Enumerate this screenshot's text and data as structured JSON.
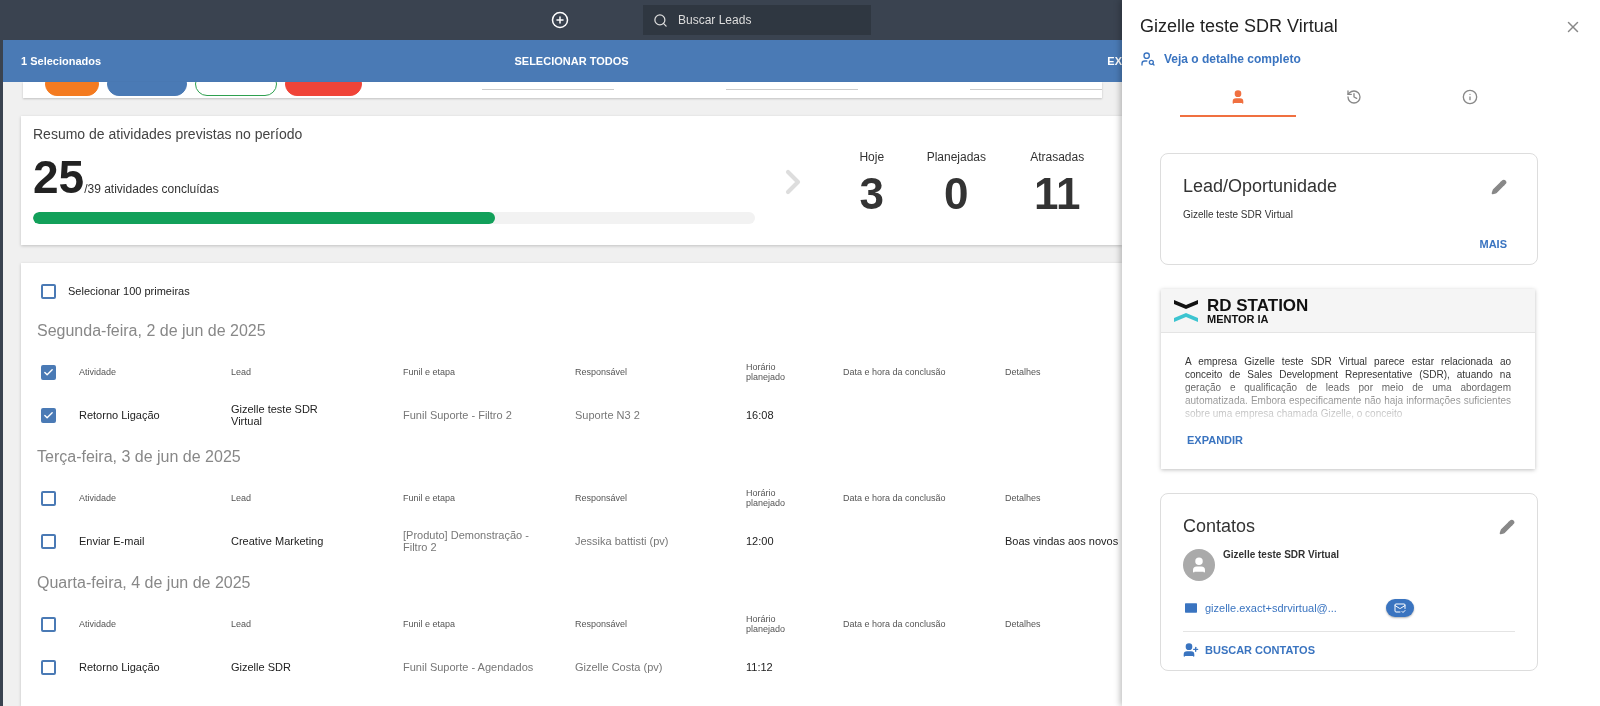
{
  "topbar": {
    "search": {
      "placeholder": "Buscar Leads"
    }
  },
  "selection_bar": {
    "count": "1 Selecionados",
    "select_all": "SELECIONAR TODOS",
    "action": "EX"
  },
  "filters": {
    "chips": [
      {
        "kind": "filled",
        "color": "#f47b20"
      },
      {
        "kind": "filled",
        "color": "#4a7ab5"
      },
      {
        "kind": "outline",
        "color": "#2ea04f"
      },
      {
        "kind": "filled",
        "color": "#f04438"
      }
    ],
    "fields": [
      {
        "kind": "select"
      },
      {
        "kind": "select"
      },
      {
        "kind": "select"
      }
    ]
  },
  "summary": {
    "title": "Resumo de atividades previstas no período",
    "done": "25",
    "total": "/39 atividades concluídas",
    "level": 0.64,
    "stats": [
      {
        "label": "Hoje",
        "value": "3"
      },
      {
        "label": "Planejadas",
        "value": "0"
      },
      {
        "label": "Atrasadas",
        "value": "11"
      }
    ]
  },
  "list": {
    "select_first": {
      "label": "Selecionar 100 primeiras",
      "checked": false
    },
    "groups": [
      {
        "date": "Segunda-feira, 2 de jun de 2025",
        "header_checked": true,
        "columns": [
          "Atividade",
          "Lead",
          "Funil e etapa",
          "Responsável",
          "Horário planejado",
          "Data e hora da conclusão",
          "Detalhes"
        ],
        "rows": [
          {
            "checked": true,
            "cells": [
              "Retorno Ligação",
              "Gizelle teste SDR Virtual",
              "Funil Suporte - Filtro 2",
              "Suporte N3 2",
              "16:08",
              "",
              ""
            ]
          }
        ]
      },
      {
        "date": "Terça-feira, 3 de jun de 2025",
        "header_checked": false,
        "columns": [
          "Atividade",
          "Lead",
          "Funil e etapa",
          "Responsável",
          "Horário planejado",
          "Data e hora da conclusão",
          "Detalhes"
        ],
        "rows": [
          {
            "checked": false,
            "cells": [
              "Enviar E-mail",
              "Creative Marketing",
              "[Produto] Demonstração - Filtro 2",
              "Jessika battisti (pv)",
              "12:00",
              "",
              "Boas vindas aos novos"
            ]
          }
        ]
      },
      {
        "date": "Quarta-feira, 4 de jun de 2025",
        "header_checked": false,
        "columns": [
          "Atividade",
          "Lead",
          "Funil e etapa",
          "Responsável",
          "Horário planejado",
          "Data e hora da conclusão",
          "Detalhes"
        ],
        "rows": [
          {
            "checked": false,
            "cells": [
              "Retorno Ligação",
              "Gizelle SDR",
              "Funil Suporte - Agendados",
              "Gizelle Costa (pv)",
              "11:12",
              "",
              ""
            ]
          }
        ]
      }
    ]
  },
  "drawer": {
    "title": "Gizelle teste SDR Virtual",
    "link": "Veja o detalhe completo",
    "tabs": [
      {
        "kind": "person",
        "selected": true
      },
      {
        "kind": "history",
        "selected": false
      },
      {
        "kind": "info",
        "selected": false
      }
    ],
    "lead_card": {
      "title": "Lead/Oportunidade",
      "name": "Gizelle teste SDR Virtual",
      "more": "MAIS"
    },
    "mentor": {
      "brand": "RD STATION",
      "sub": "MENTOR IA",
      "text": "A empresa Gizelle teste SDR Virtual parece estar relacionada ao conceito de Sales Development Representative (SDR), atuando na geração e qualificação de leads por meio de uma abordagem automatizada. Embora especificamente não haja informações suficientes sobre uma empresa chamada Gizelle, o conceito",
      "expand": "EXPANDIR"
    },
    "contacts": {
      "title": "Contatos",
      "name": "Gizelle teste SDR Virtual",
      "email": "gizelle.exact+sdrvirtual@...",
      "search_button": "BUSCAR CONTATOS"
    }
  }
}
